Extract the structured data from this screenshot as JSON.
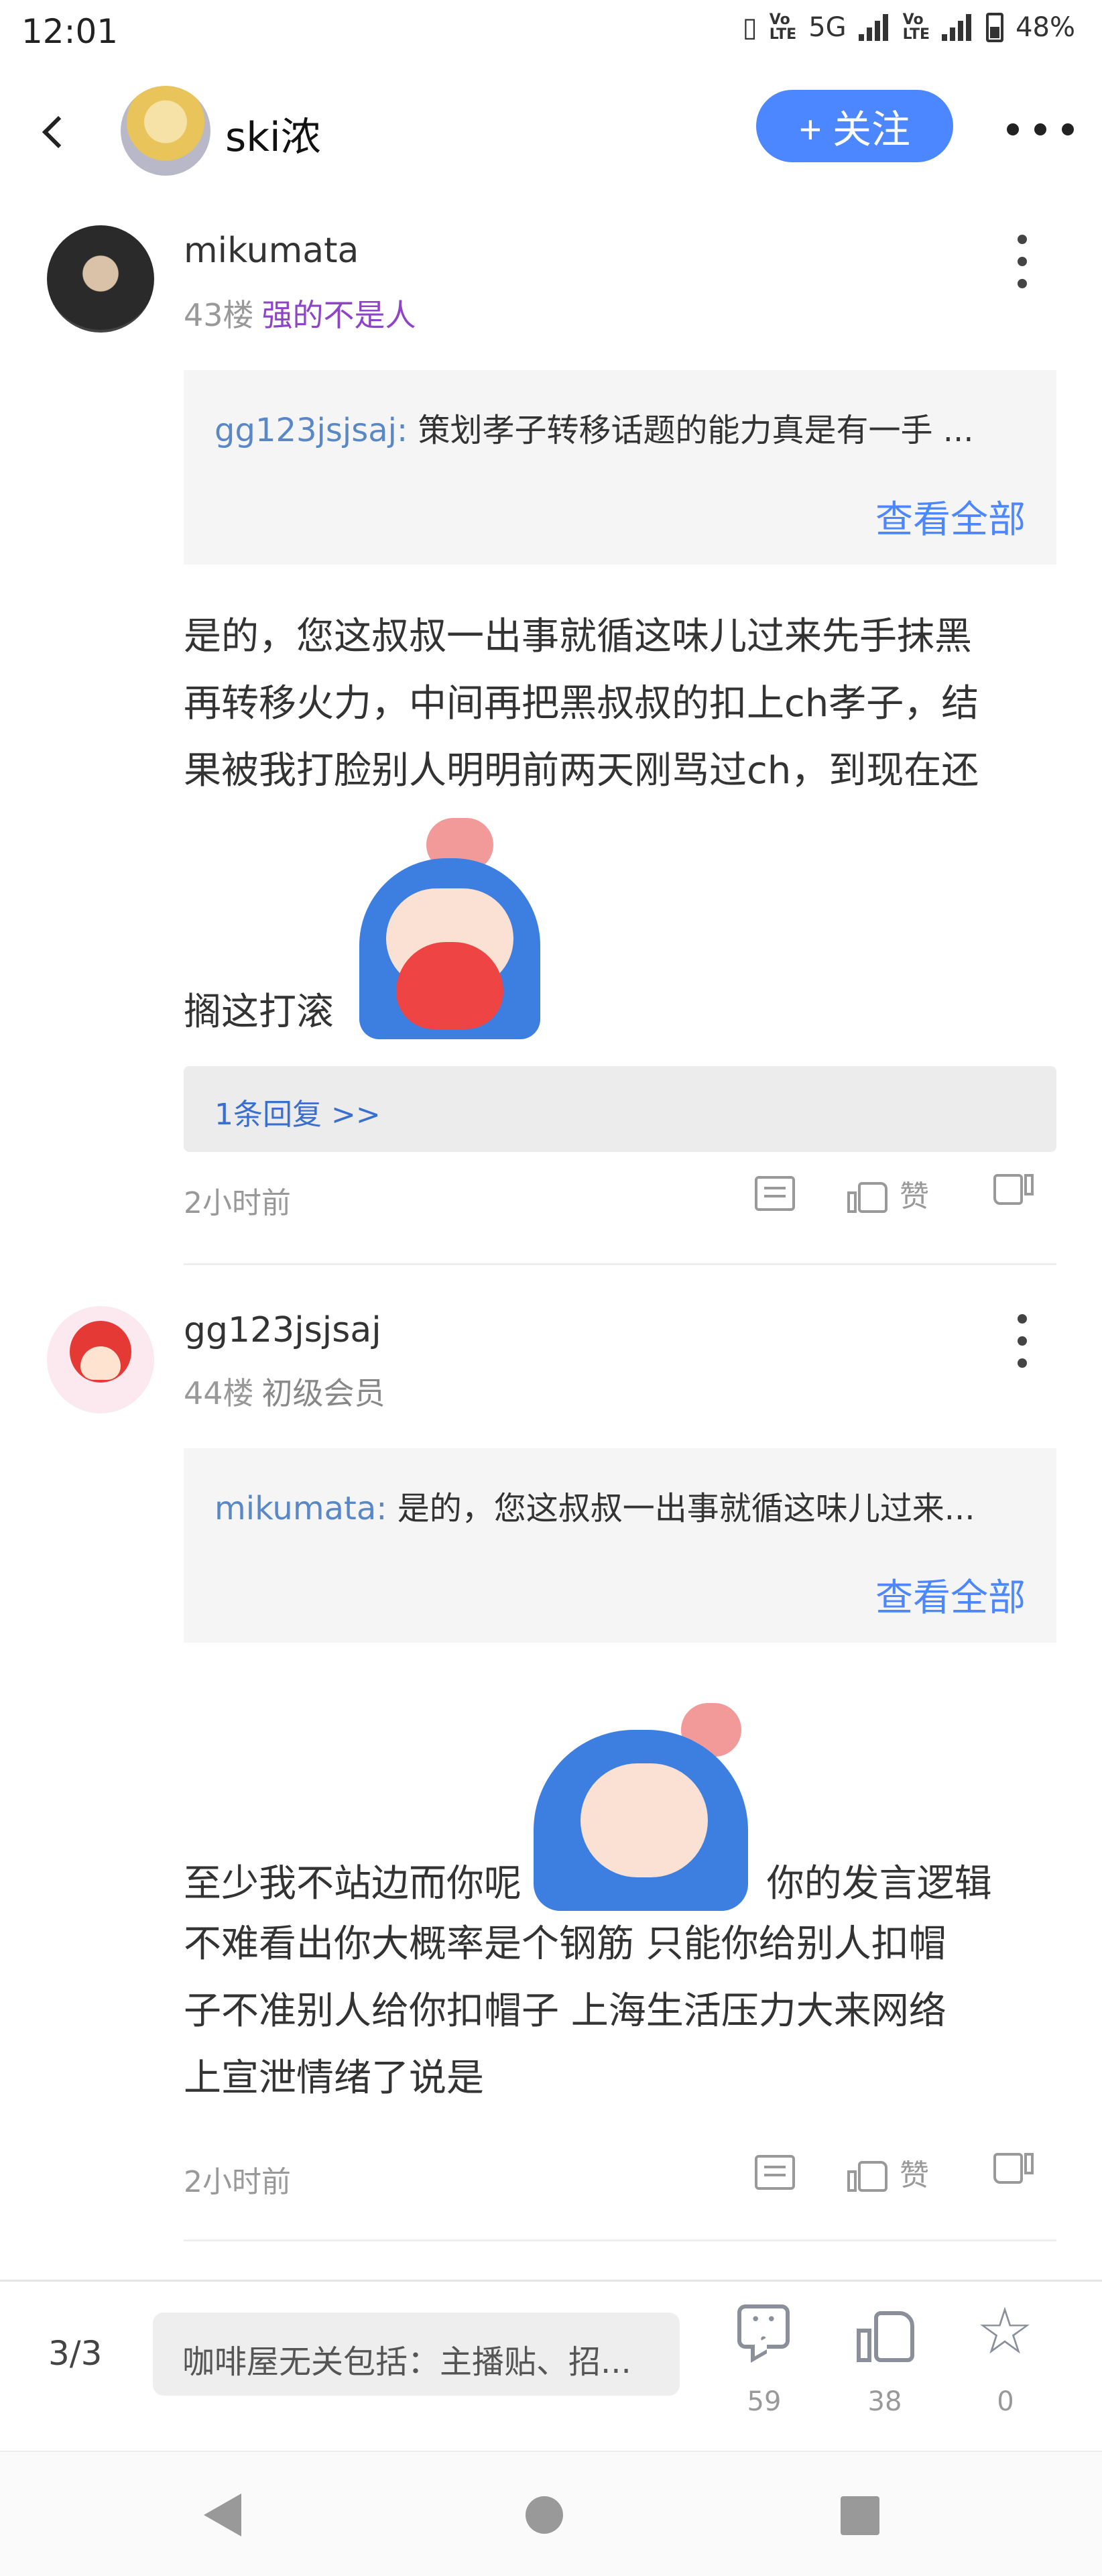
{
  "status_bar": {
    "time": "12:01",
    "network": "5G",
    "volte_1": "Vo LTE",
    "volte_2": "Vo LTE",
    "battery": "48%"
  },
  "header": {
    "title": "ski浓",
    "follow_label": "+ 关注",
    "accent_color": "#4d87ff"
  },
  "posts": [
    {
      "username": "mikumata",
      "floor": "43楼",
      "rank": "强的不是人",
      "quote_user": "gg123jsjsaj:",
      "quote_text": "策划孝子转移话题的能力真是有一手 ...",
      "view_all": "查看全部",
      "content_lines": [
        "是的，您这叔叔一出事就循这味儿过来先手抹黑",
        "再转移火力，中间再把黑叔叔的扣上ch孝子，结",
        "果被我打脸别人明明前两天刚骂过ch，到现在还"
      ],
      "content_tail": "搁这打滚",
      "replies_label": "1条回复 >>",
      "time": "2小时前",
      "like_label": "赞"
    },
    {
      "username": "gg123jsjsaj",
      "floor": "44楼",
      "rank": "初级会员",
      "quote_user": "mikumata:",
      "quote_text": "是的，您这叔叔一出事就循这味儿过来...",
      "view_all": "查看全部",
      "content_head": "至少我不站边而你呢",
      "content_after_sticker": "你的发言逻辑",
      "content_lines": [
        "不难看出你大概率是个钢筋  只能你给别人扣帽",
        "子不准别人给你扣帽子  上海生活压力大来网络",
        "上宣泄情绪了说是"
      ],
      "time": "2小时前",
      "like_label": "赞"
    }
  ],
  "bottom_bar": {
    "page_info": "3/3",
    "topic": "咖啡屋无关包括：主播贴、招...",
    "comments": "59",
    "likes": "38",
    "favorites": "0"
  },
  "icons": {
    "back": "back-arrow-icon",
    "more": "more-horizontal-icon",
    "comment": "comment-icon",
    "like": "thumbs-up-icon",
    "dislike": "thumbs-down-icon",
    "star": "star-icon"
  }
}
